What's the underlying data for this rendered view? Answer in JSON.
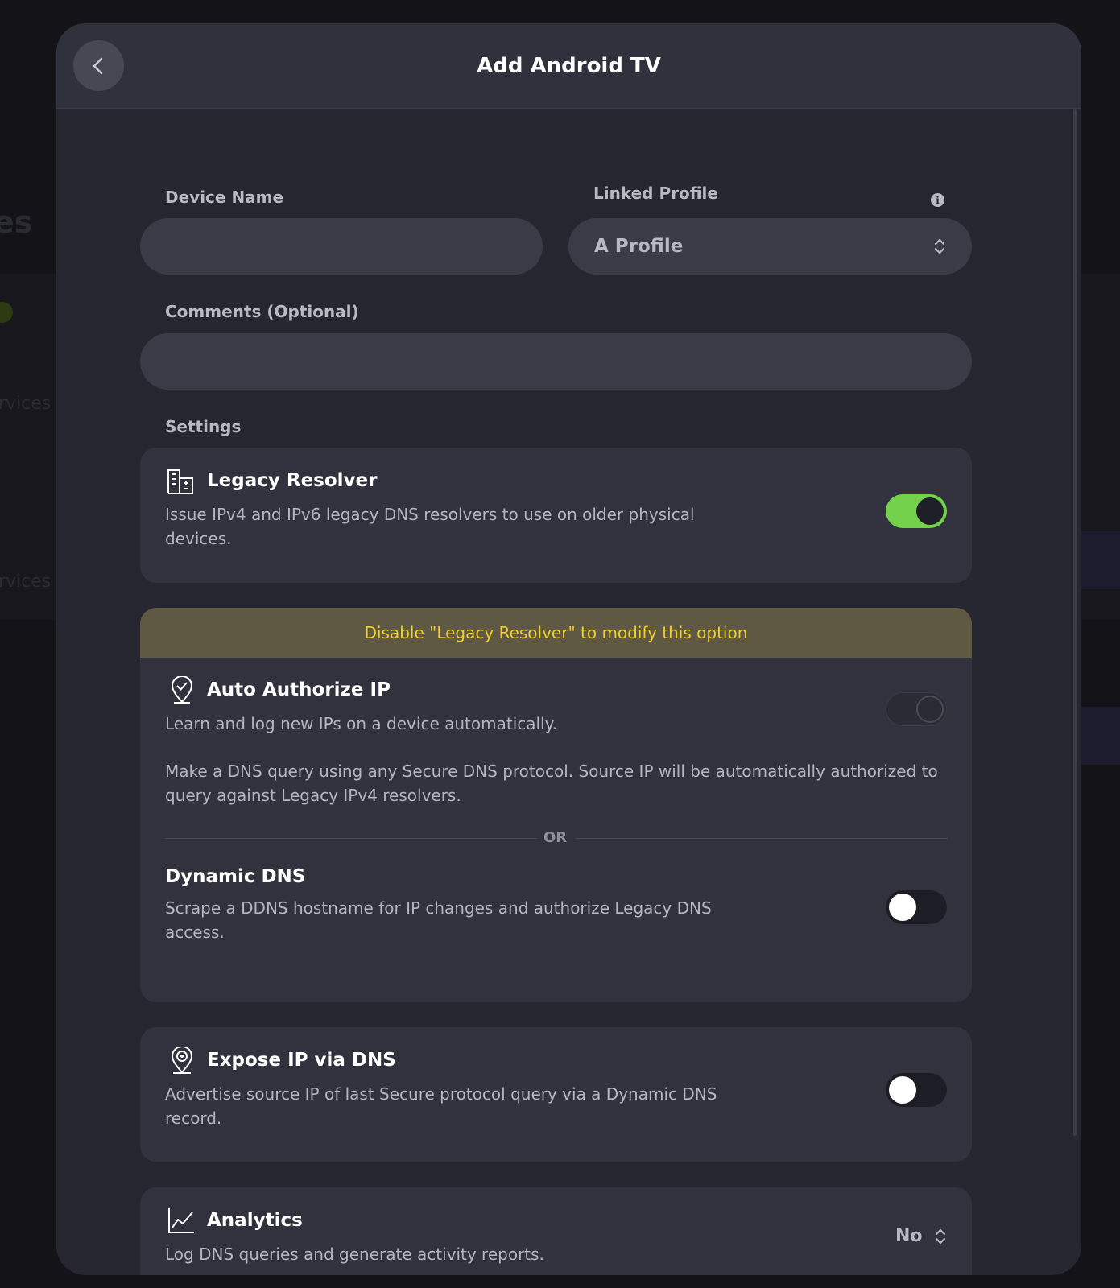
{
  "background": {
    "partial_heading": "es",
    "partial_text_1": "rvices",
    "partial_text_2": "rvices"
  },
  "header": {
    "title": "Add Android TV",
    "back_icon": "chevron-left-icon"
  },
  "form": {
    "device_name_label": "Device Name",
    "device_name_value": "",
    "linked_profile_label": "Linked Profile",
    "linked_profile_value": "A Profile",
    "comments_label": "Comments (Optional)",
    "comments_value": "",
    "settings_label": "Settings"
  },
  "settings": {
    "legacy_resolver": {
      "title": "Legacy Resolver",
      "description": "Issue IPv4 and IPv6 legacy DNS resolvers to use on older physical devices.",
      "enabled": true,
      "icon": "building-icon"
    },
    "auto_authorize": {
      "warning": "Disable \"Legacy Resolver\" to modify this option",
      "title": "Auto Authorize IP",
      "description": "Learn and log new IPs on a device automatically.",
      "detail": "Make a DNS query using any Secure DNS protocol. Source IP will be automatically authorized to query against Legacy IPv4 resolvers.",
      "enabled": false,
      "icon": "location-check-icon"
    },
    "or_label": "OR",
    "dynamic_dns": {
      "title": "Dynamic DNS",
      "description": "Scrape a DDNS hostname for IP changes and authorize Legacy DNS access.",
      "enabled": false
    },
    "expose_ip": {
      "title": "Expose IP via DNS",
      "description": "Advertise source IP of last Secure protocol query via a Dynamic DNS record.",
      "enabled": false,
      "icon": "location-radar-icon"
    },
    "analytics": {
      "title": "Analytics",
      "description": "Log DNS queries and generate activity reports.",
      "value": "No",
      "icon": "line-chart-icon"
    }
  },
  "colors": {
    "accent_green": "#74d14c",
    "warning_text": "#f0cf2e",
    "warning_bg": "#5f5943"
  }
}
